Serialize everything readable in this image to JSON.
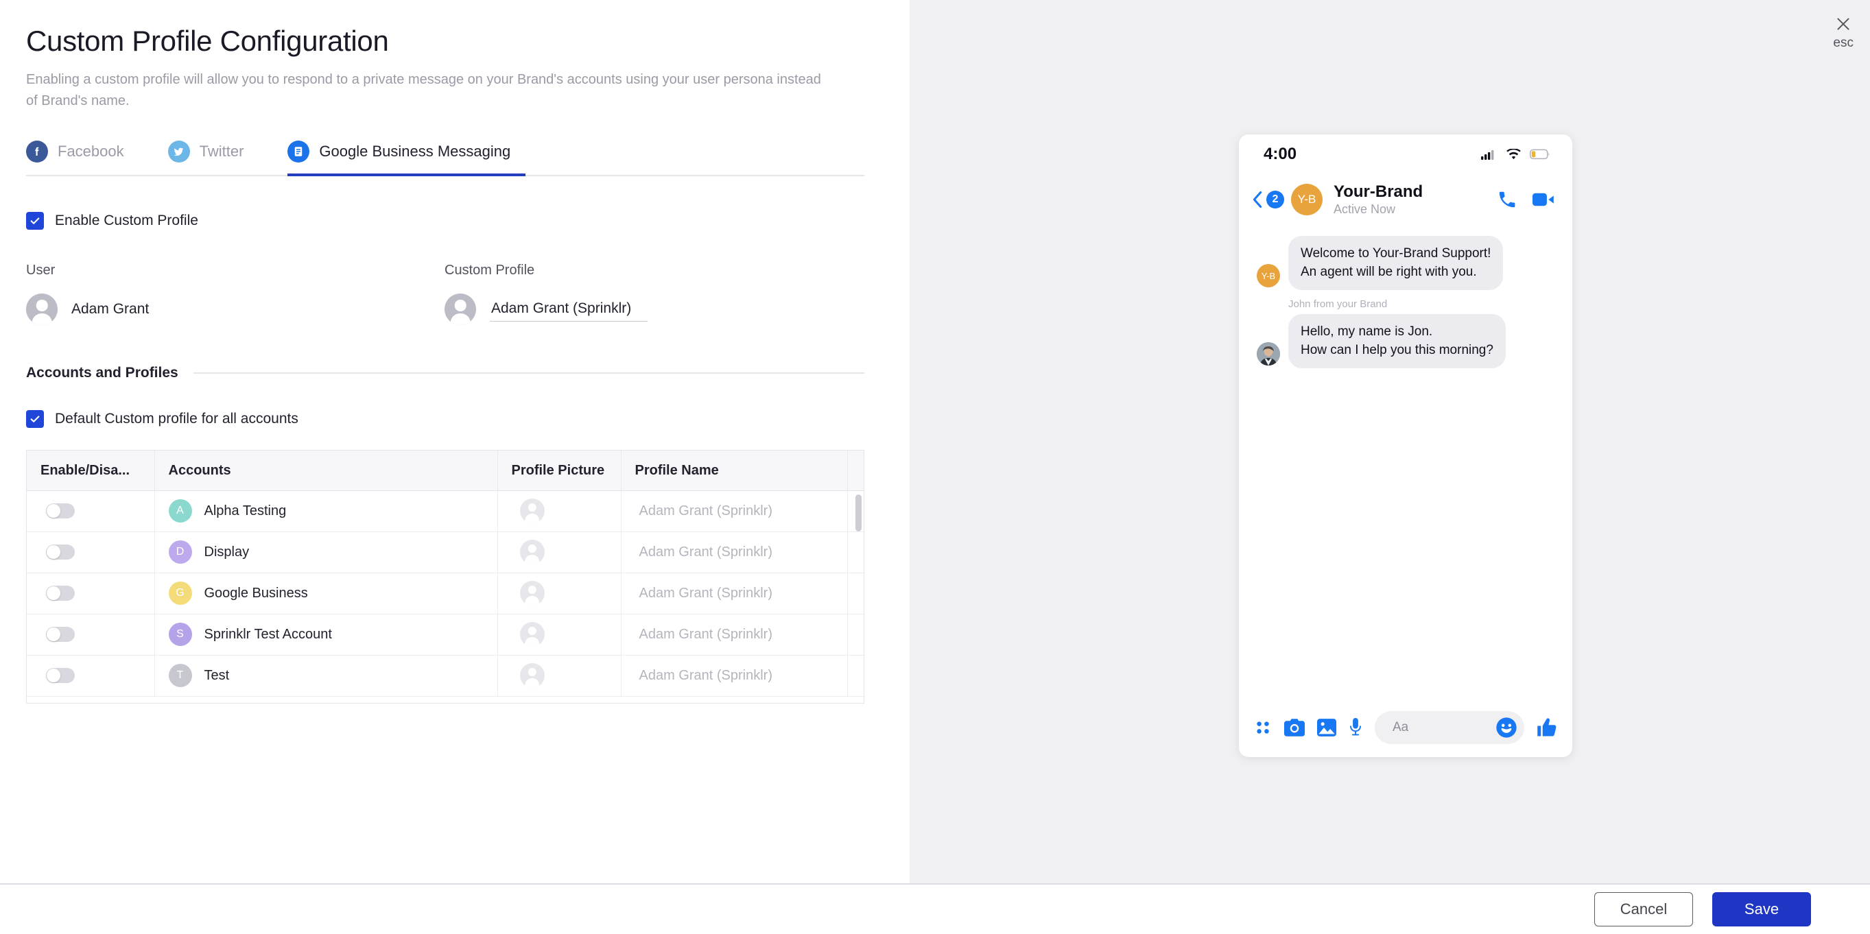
{
  "page": {
    "title": "Custom Profile Configuration",
    "subtitle": "Enabling a custom profile will allow you to respond to a private message on your Brand's accounts using your user persona instead of Brand's name."
  },
  "close": {
    "label": "esc",
    "icon": "close-icon"
  },
  "tabs": [
    {
      "label": "Facebook",
      "icon": "facebook-icon",
      "active": false
    },
    {
      "label": "Twitter",
      "icon": "twitter-icon",
      "active": false
    },
    {
      "label": "Google Business Messaging",
      "icon": "google-business-messaging-icon",
      "active": true
    }
  ],
  "enable_custom_profile": {
    "label": "Enable Custom Profile",
    "checked": true
  },
  "user": {
    "title": "User",
    "name": "Adam Grant"
  },
  "custom_profile": {
    "title": "Custom Profile",
    "name": "Adam Grant (Sprinklr)"
  },
  "accounts_section": {
    "title": "Accounts and Profiles",
    "default_checkbox": {
      "label": "Default Custom profile for all accounts",
      "checked": true
    }
  },
  "table": {
    "columns": [
      "Enable/Disa...",
      "Accounts",
      "Profile Picture",
      "Profile Name",
      ""
    ],
    "rows": [
      {
        "enabled": false,
        "initial": "A",
        "color": "#8ad8ce",
        "account": "Alpha Testing",
        "profile_name": "Adam Grant (Sprinklr)"
      },
      {
        "enabled": false,
        "initial": "D",
        "color": "#bda9ec",
        "account": "Display",
        "profile_name": "Adam Grant (Sprinklr)"
      },
      {
        "enabled": false,
        "initial": "G",
        "color": "#f3db7a",
        "account": "Google Business",
        "profile_name": "Adam Grant (Sprinklr)"
      },
      {
        "enabled": false,
        "initial": "S",
        "color": "#b4a3e8",
        "account": "Sprinklr Test Account",
        "profile_name": "Adam Grant (Sprinklr)"
      },
      {
        "enabled": false,
        "initial": "T",
        "color": "#c6c7cf",
        "account": "Test",
        "profile_name": "Adam Grant (Sprinklr)"
      }
    ]
  },
  "preview": {
    "status_bar": {
      "time": "4:00",
      "icons": [
        "cellular-signal-icon",
        "wifi-icon",
        "battery-icon"
      ]
    },
    "header": {
      "back_icon": "back-chevron-icon",
      "unread_count": "2",
      "avatar_initials": "Y-B",
      "brand_name": "Your-Brand",
      "status": "Active Now",
      "actions": [
        "phone-call-icon",
        "video-call-icon"
      ]
    },
    "messages": [
      {
        "avatar_initials": "Y-B",
        "sender": "",
        "text": "Welcome to Your-Brand Support!\nAn agent will be right with you."
      },
      {
        "avatar_initials": "",
        "sender": "John from your Brand",
        "text": "Hello, my name is Jon.\nHow can I help you this morning?"
      }
    ],
    "input_bar": {
      "icons": [
        "apps-grid-icon",
        "camera-icon",
        "photo-icon",
        "microphone-icon"
      ],
      "placeholder": "Aa",
      "emoji_icon": "smiley-icon",
      "like_icon": "thumbs-up-icon"
    }
  },
  "footer": {
    "cancel": "Cancel",
    "save": "Save"
  },
  "colors": {
    "accent_blue": "#1f36c4",
    "tab_active_underline": "#1f3fbf",
    "brand_orange": "#e8a33d",
    "messenger_blue": "#1877f2"
  }
}
